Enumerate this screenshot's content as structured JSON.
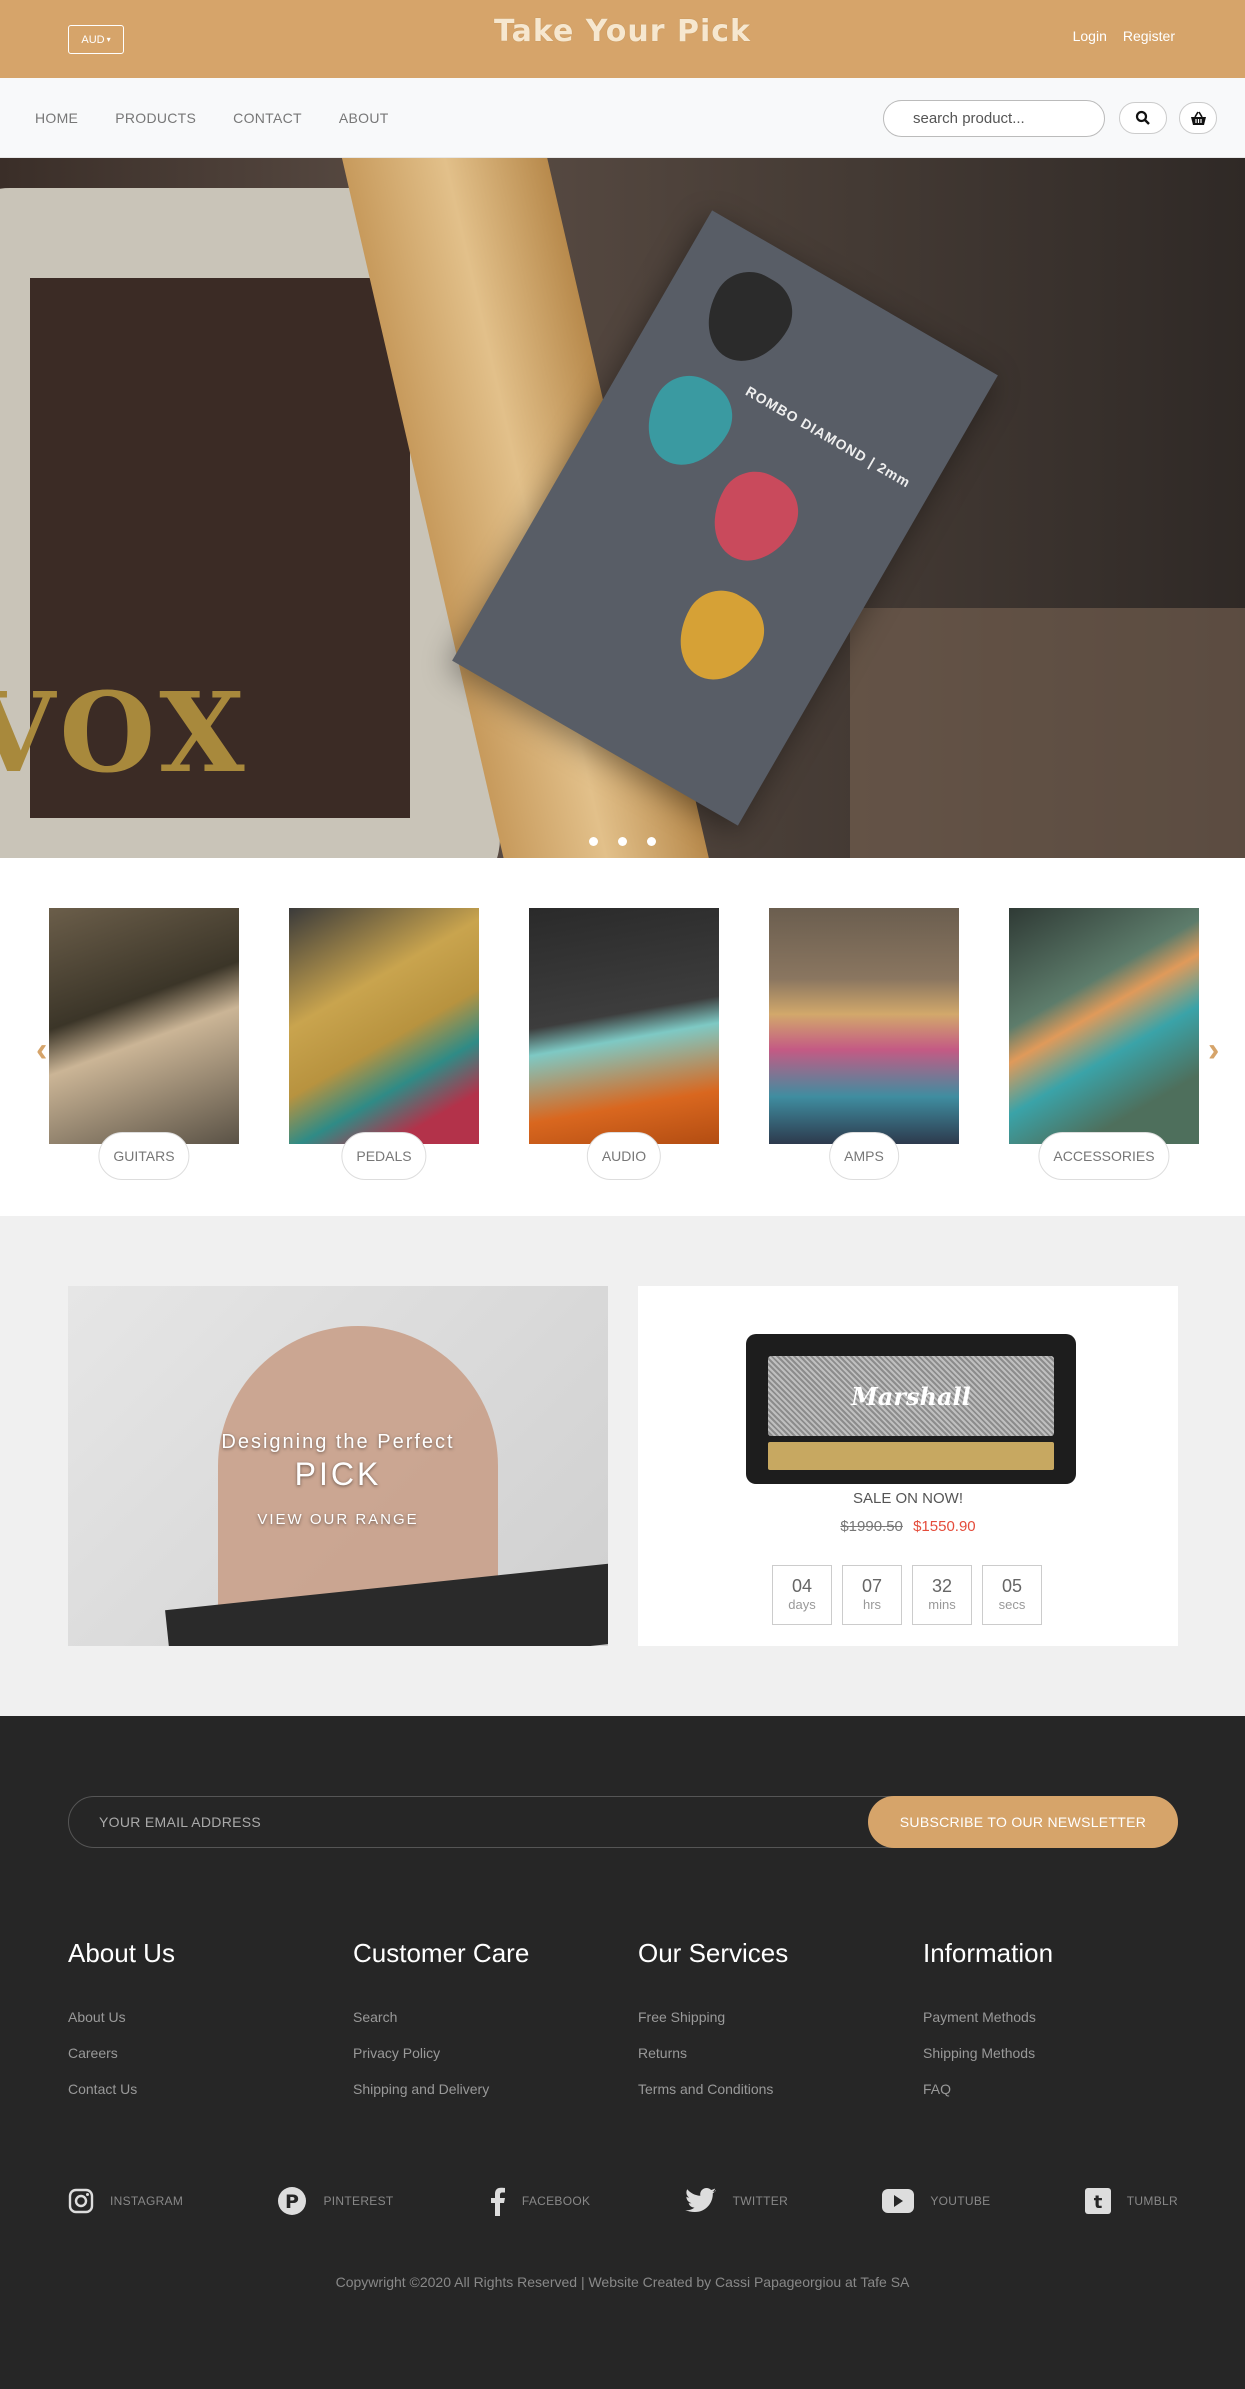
{
  "header": {
    "currency": "AUD",
    "logo": "Take Your Pick",
    "login": "Login",
    "register": "Register"
  },
  "nav": {
    "items": [
      "HOME",
      "PRODUCTS",
      "CONTACT",
      "ABOUT"
    ],
    "search_placeholder": "search product..."
  },
  "hero": {
    "slides": 3,
    "card_text": "ROMBO DIAMOND | 2mm"
  },
  "categories": {
    "items": [
      "GUITARS",
      "PEDALS",
      "AUDIO",
      "AMPS",
      "ACCESSORIES"
    ]
  },
  "promo": {
    "banner_line1": "Designing the Perfect",
    "banner_line2": "PICK",
    "banner_cta": "VIEW OUR RANGE",
    "sale_label": "SALE ON NOW!",
    "old_price": "$1990.50",
    "new_price": "$1550.90",
    "amp_brand": "Marshall",
    "timer": [
      {
        "value": "04",
        "unit": "days"
      },
      {
        "value": "07",
        "unit": "hrs"
      },
      {
        "value": "32",
        "unit": "mins"
      },
      {
        "value": "05",
        "unit": "secs"
      }
    ]
  },
  "footer": {
    "email_placeholder": "YOUR EMAIL ADDRESS",
    "subscribe": "SUBSCRIBE TO OUR NEWSLETTER",
    "columns": [
      {
        "title": "About Us",
        "links": [
          "About Us",
          "Careers",
          "Contact Us"
        ]
      },
      {
        "title": "Customer Care",
        "links": [
          "Search",
          "Privacy Policy",
          "Shipping and Delivery"
        ]
      },
      {
        "title": "Our Services",
        "links": [
          "Free Shipping",
          "Returns",
          "Terms and Conditions"
        ]
      },
      {
        "title": "Information",
        "links": [
          "Payment Methods",
          "Shipping Methods",
          "FAQ"
        ]
      }
    ],
    "social": [
      "INSTAGRAM",
      "PINTEREST",
      "FACEBOOK",
      "TWITTER",
      "YOUTUBE",
      "TUMBLR"
    ],
    "copyright": "Copywright ©2020 All Rights Reserved | Website Created by Cassi Papageorgiou at Tafe SA"
  },
  "colors": {
    "brand": "#d6a46a",
    "footer_bg": "#262626",
    "sale_price": "#e44c3b"
  }
}
